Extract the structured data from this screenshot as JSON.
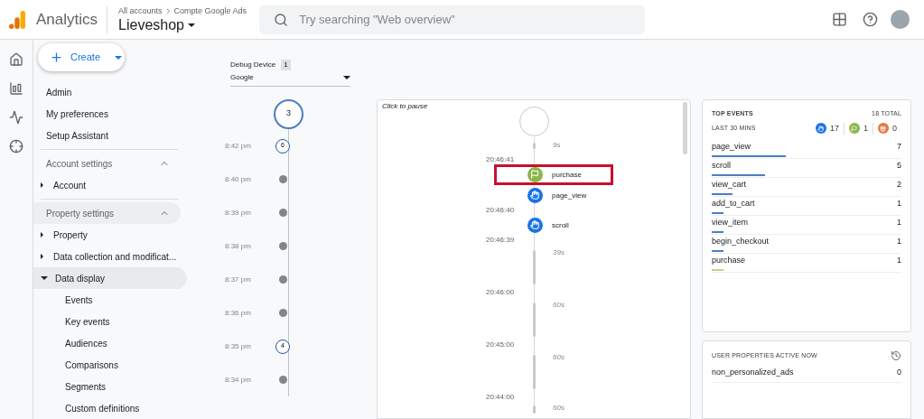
{
  "header": {
    "product": "Analytics",
    "breadcrumb": [
      "All accounts",
      "Compte Google Ads"
    ],
    "property": "Lieveshop",
    "search": {
      "placeholder": "Try searching \"Web overview\""
    }
  },
  "create_button": {
    "label": "Create"
  },
  "nav": {
    "items": [
      {
        "label": "Admin"
      },
      {
        "label": "My preferences"
      },
      {
        "label": "Setup Assistant"
      }
    ],
    "sections": [
      {
        "title": "Account settings",
        "expanded": true,
        "selected": false,
        "items": [
          {
            "label": "Account",
            "expanded": false,
            "selected": false
          }
        ]
      },
      {
        "title": "Property settings",
        "expanded": true,
        "selected": true,
        "items": [
          {
            "label": "Property",
            "expanded": false,
            "selected": false
          },
          {
            "label": "Data collection and modificat...",
            "expanded": false,
            "selected": false
          },
          {
            "label": "Data display",
            "expanded": true,
            "selected": true,
            "children": [
              {
                "label": "Events"
              },
              {
                "label": "Key events"
              },
              {
                "label": "Audiences"
              },
              {
                "label": "Comparisons"
              },
              {
                "label": "Segments"
              },
              {
                "label": "Custom definitions"
              }
            ]
          }
        ]
      }
    ]
  },
  "debug_device": {
    "label": "Debug Device",
    "count": "1",
    "value": "Google"
  },
  "minutes": {
    "current": "3",
    "rows": [
      {
        "time": "8:42 pm",
        "kind": "count",
        "count": "6"
      },
      {
        "time": "8:40 pm",
        "kind": "dot"
      },
      {
        "time": "8:39 pm",
        "kind": "dot"
      },
      {
        "time": "8:38 pm",
        "kind": "dot"
      },
      {
        "time": "8:37 pm",
        "kind": "dot"
      },
      {
        "time": "8:36 pm",
        "kind": "dot"
      },
      {
        "time": "8:35 pm",
        "kind": "count",
        "count": "4"
      },
      {
        "time": "8:34 pm",
        "kind": "dot"
      }
    ]
  },
  "stream": {
    "hint": "Click to pause",
    "items": [
      {
        "kind": "short_gap",
        "label": "9s"
      },
      {
        "kind": "time",
        "label": "20:46:41"
      },
      {
        "kind": "key_event",
        "name": "purchase",
        "highlighted": true
      },
      {
        "kind": "event",
        "name": "page_view",
        "highlighted": false
      },
      {
        "kind": "time",
        "label": "20:46:40"
      },
      {
        "kind": "event",
        "name": "scroll",
        "highlighted": false
      },
      {
        "kind": "time",
        "label": "20:46:39"
      },
      {
        "kind": "long_gap",
        "label": "39s"
      },
      {
        "kind": "time",
        "label": "20:46:00"
      },
      {
        "kind": "long_gap",
        "label": "60s"
      },
      {
        "kind": "time",
        "label": "20:45:00"
      },
      {
        "kind": "long_gap",
        "label": "60s"
      },
      {
        "kind": "time",
        "label": "20:44:00"
      },
      {
        "kind": "last_gap",
        "label": "60s"
      }
    ]
  },
  "top_events": {
    "title": "TOP EVENTS",
    "total": "18 TOTAL",
    "period": "LAST 30 MINS",
    "summary": [
      {
        "kind": "event",
        "count": "17"
      },
      {
        "kind": "key_event",
        "count": "1"
      },
      {
        "kind": "error",
        "count": "0"
      }
    ],
    "rows": [
      {
        "name": "page_view",
        "count": "7",
        "level": 0.39,
        "color": "#4a7fc1"
      },
      {
        "name": "scroll",
        "count": "5",
        "level": 0.28,
        "color": "#4a7fc1"
      },
      {
        "name": "view_cart",
        "count": "2",
        "level": 0.11,
        "color": "#4a7fc1"
      },
      {
        "name": "add_to_cart",
        "count": "1",
        "level": 0.06,
        "color": "#4a7fc1"
      },
      {
        "name": "view_item",
        "count": "1",
        "level": 0.06,
        "color": "#4a7fc1"
      },
      {
        "name": "begin_checkout",
        "count": "1",
        "level": 0.06,
        "color": "#4a7fc1"
      },
      {
        "name": "purchase",
        "count": "1",
        "level": 0.06,
        "color": "#c5cf8a"
      }
    ]
  },
  "user_properties": {
    "title": "USER PROPERTIES ACTIVE NOW",
    "rows": [
      {
        "name": "non_personalized_ads",
        "count": "0"
      }
    ]
  }
}
